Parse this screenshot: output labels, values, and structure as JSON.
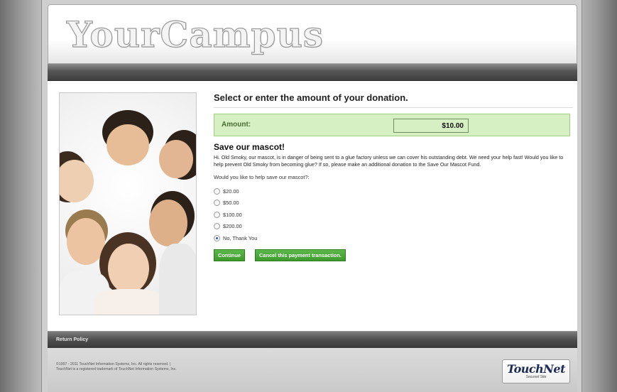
{
  "header": {
    "logo_text": "YourCampus"
  },
  "content": {
    "heading": "Select or enter the amount of your donation.",
    "amount_label": "Amount:",
    "amount_value": "$10.00",
    "mascot_title": "Save our mascot!",
    "mascot_text": "Hi. Old Smoky, our mascot, is in danger of being sent to a glue factory unless we can cover his outstanding debt. We need your help fast! Would you like to help prevent Old Smoky from becoming glue? If so, please make an additional donation to the Save Our Mascot Fund.",
    "question": "Would you like to help save our mascot?:",
    "options": [
      {
        "label": "$20.00",
        "checked": false
      },
      {
        "label": "$50.00",
        "checked": false
      },
      {
        "label": "$100.00",
        "checked": false
      },
      {
        "label": "$200.00",
        "checked": false
      },
      {
        "label": "No, Thank You",
        "checked": true
      }
    ],
    "continue_label": "Continue",
    "cancel_label": "Cancel this payment transaction."
  },
  "footer": {
    "return_policy": "Return Policy",
    "copyright_line1": "©1997 - 2011 TouchNet Information Systems, Inc. All rights reserved. |",
    "copyright_line2": "TouchNet is a registered trademark of TouchNet Information Systems, Inc.",
    "badge_word": "TouchNet",
    "badge_sub": "Secured Site"
  },
  "colors": {
    "accent_green": "#3d9b2c",
    "amount_bg": "#d6efc3",
    "nav_dark": "#3f3f3f"
  }
}
